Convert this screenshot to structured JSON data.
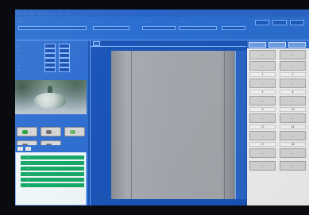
{
  "colors": {
    "app_blue": "#2f6fd0",
    "plot_gray": "#a3a8ae",
    "status_green": "#18a868"
  },
  "menubar": {
    "items": [
      "...",
      "...",
      "...",
      "...",
      "...",
      "...",
      "...",
      "..."
    ]
  },
  "toolbar": {
    "fields": [
      "...",
      "...",
      "...",
      "..."
    ]
  },
  "left": {
    "rows": [
      {
        "k": "...",
        "v": ""
      },
      {
        "k": "...",
        "v": ""
      },
      {
        "k": "...",
        "v": ""
      },
      {
        "k": "...",
        "v": ""
      },
      {
        "k": "...",
        "v": ""
      },
      {
        "k": "...",
        "v": ""
      }
    ],
    "buttons": [
      "...",
      "...",
      "...",
      "...",
      "..."
    ]
  },
  "chart": {
    "tab_label": "...",
    "y_ticks": [
      "",
      "",
      "",
      "",
      "",
      "",
      "",
      "",
      "",
      "",
      ""
    ],
    "x_ticks": [
      "",
      "",
      "",
      "",
      "",
      "",
      "",
      "",
      ""
    ]
  },
  "tree": {
    "tabs": [
      "...",
      "..."
    ],
    "items": [
      "...",
      "...",
      "...",
      "...",
      "...",
      "..."
    ]
  },
  "grid": {
    "numbers": [
      "1",
      "2",
      "5",
      "6",
      "9",
      "10",
      "13",
      "14",
      "17",
      "18"
    ],
    "well_label": "..."
  }
}
